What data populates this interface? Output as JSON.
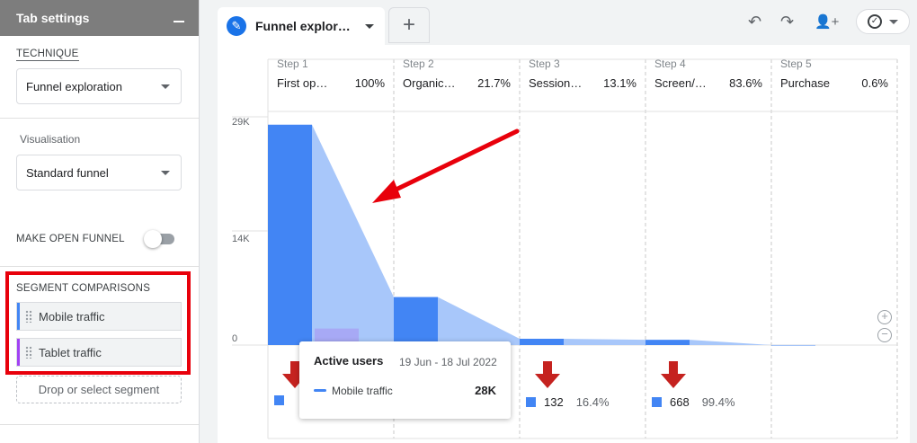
{
  "panel": {
    "title": "Tab settings",
    "technique_label": "TECHNIQUE",
    "technique_value": "Funnel exploration",
    "visualisation_label": "Visualisation",
    "visualisation_value": "Standard funnel",
    "open_funnel_label": "MAKE OPEN FUNNEL",
    "open_funnel_on": false,
    "segment_label": "SEGMENT COMPARISONS",
    "segments": [
      {
        "label": "Mobile traffic",
        "color": "#4285f4"
      },
      {
        "label": "Tablet traffic",
        "color": "#a142f4"
      }
    ],
    "drop_label": "Drop or select segment"
  },
  "tabs": {
    "active_label": "Funnel explor…",
    "add_label": "+"
  },
  "toolbar": {
    "undo": "↶",
    "redo": "↷",
    "share": "👤+",
    "check": "✓"
  },
  "funnel": {
    "steps": [
      {
        "num": "Step 1",
        "name": "First op…",
        "pct": "100%"
      },
      {
        "num": "Step 2",
        "name": "Organic…",
        "pct": "21.7%"
      },
      {
        "num": "Step 3",
        "name": "Session…",
        "pct": "13.1%"
      },
      {
        "num": "Step 4",
        "name": "Screen/…",
        "pct": "83.6%"
      },
      {
        "num": "Step 5",
        "name": "Purchase",
        "pct": "0.6%"
      }
    ],
    "yticks": [
      "29K",
      "14K",
      "0"
    ],
    "bottom": [
      {
        "value": "132",
        "pct": "16.4%"
      },
      {
        "value": "668",
        "pct": "99.4%"
      }
    ]
  },
  "chart_data": {
    "type": "bar",
    "categories": [
      "First op…",
      "Organic…",
      "Session…",
      "Screen/…",
      "Purchase"
    ],
    "series": [
      {
        "name": "Mobile traffic",
        "values": [
          28000,
          6100,
          800,
          668,
          4
        ]
      },
      {
        "name": "Tablet traffic",
        "values": [
          2100,
          0,
          0,
          0,
          0
        ]
      }
    ],
    "ylim": [
      0,
      29000
    ],
    "colors": {
      "mobile": "#4285f4",
      "mobile_fill": "#a8c7fa",
      "tablet": "#a7a9f5",
      "annotation": "#e8000b"
    }
  },
  "tooltip": {
    "title": "Active users",
    "date": "19 Jun - 18 Jul 2022",
    "series": "Mobile traffic",
    "value": "28K"
  }
}
